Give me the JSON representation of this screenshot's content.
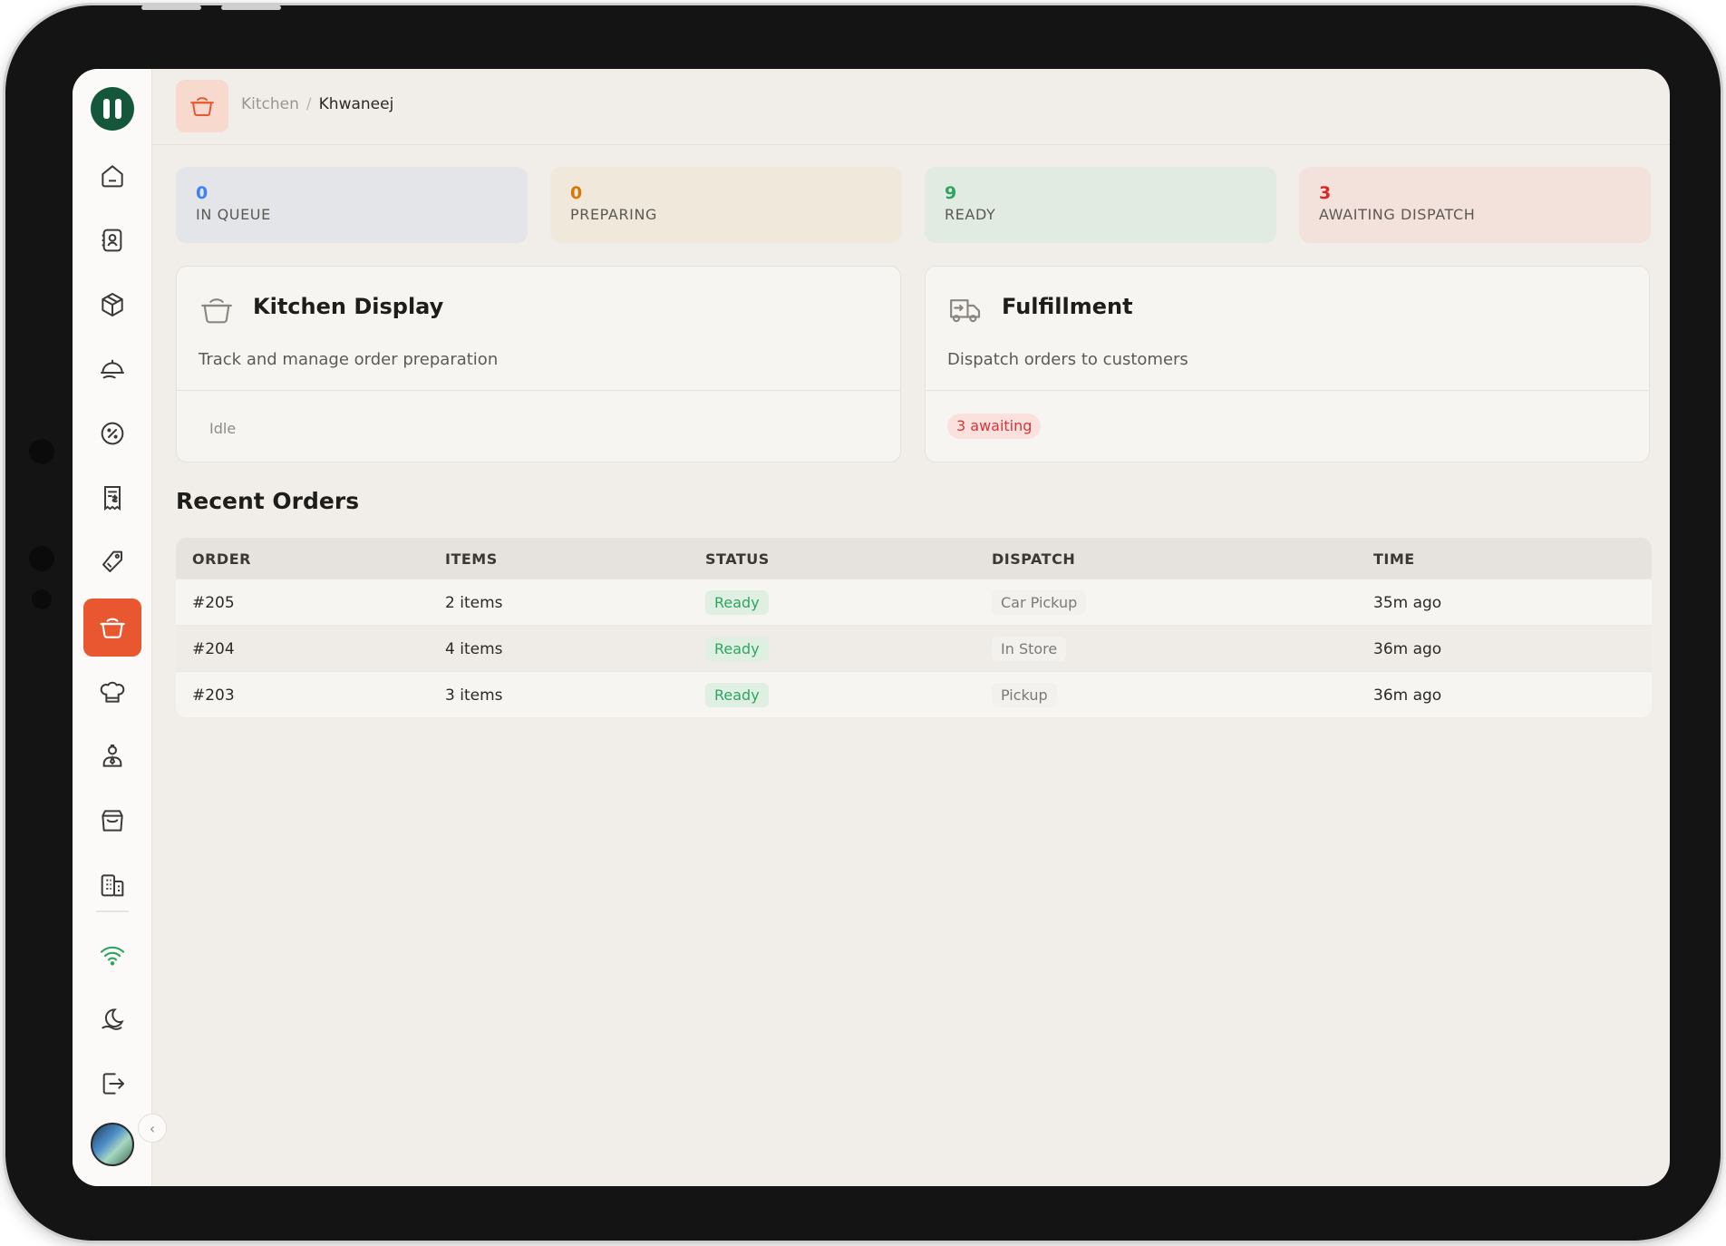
{
  "breadcrumb": {
    "root": "Kitchen",
    "separator": "/",
    "current": "Khwaneej"
  },
  "stats": [
    {
      "value": "0",
      "label": "IN QUEUE",
      "color": "#3b82f6",
      "bg": "#e4e5e9"
    },
    {
      "value": "0",
      "label": "PREPARING",
      "color": "#d97706",
      "bg": "#f1e8dc"
    },
    {
      "value": "9",
      "label": "READY",
      "color": "#2fa561",
      "bg": "#e1ebe2"
    },
    {
      "value": "3",
      "label": "AWAITING DISPATCH",
      "color": "#dc2626",
      "bg": "#f3e2db"
    }
  ],
  "cards": {
    "kitchen": {
      "title": "Kitchen Display",
      "description": "Track and manage order preparation",
      "status": "Idle",
      "icon": "cooking-pot-icon"
    },
    "fulfillment": {
      "title": "Fulfillment",
      "description": "Dispatch orders to customers",
      "status": "3 awaiting",
      "icon": "delivery-truck-icon"
    }
  },
  "recent_orders": {
    "title": "Recent Orders",
    "columns": [
      "ORDER",
      "ITEMS",
      "STATUS",
      "DISPATCH",
      "TIME"
    ],
    "rows": [
      {
        "order": "#205",
        "items": "2 items",
        "status": "Ready",
        "dispatch": "Car Pickup",
        "time": "35m ago"
      },
      {
        "order": "#204",
        "items": "4 items",
        "status": "Ready",
        "dispatch": "In Store",
        "time": "36m ago"
      },
      {
        "order": "#203",
        "items": "3 items",
        "status": "Ready",
        "dispatch": "Pickup",
        "time": "36m ago"
      }
    ]
  },
  "sidebar": {
    "items": [
      "home-icon",
      "contacts-icon",
      "inventory-box-icon",
      "service-cloche-icon",
      "discount-badge-icon",
      "receipt-icon",
      "coupon-tag-icon",
      "kitchen-pot-icon",
      "chef-hat-icon",
      "staff-icon",
      "store-icon",
      "buildings-icon",
      "wifi-icon",
      "theme-icon",
      "logout-icon"
    ],
    "active": "kitchen-pot-icon",
    "colors": {
      "brand": "#15573a",
      "active": "#e8572f",
      "wifi": "#2fa561"
    }
  }
}
